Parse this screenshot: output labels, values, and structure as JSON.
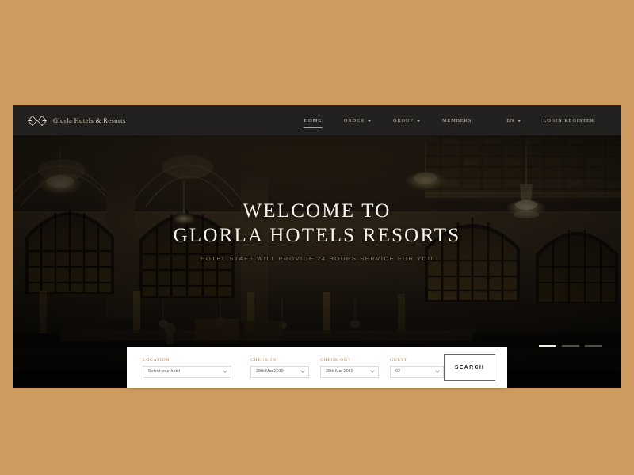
{
  "theme": {
    "page_background": "#cd9a5f",
    "header_background": "#232120",
    "accent": "#c37d3c",
    "hero_text": "#f7f3ec"
  },
  "header": {
    "brand": {
      "logo_icon": "double-diamond-monogram-icon",
      "name": "Glorla Hotels & Resorts"
    },
    "nav": [
      {
        "label": "HOME",
        "has_dropdown": false,
        "active": true
      },
      {
        "label": "ORDER",
        "has_dropdown": true,
        "active": false
      },
      {
        "label": "GROUP",
        "has_dropdown": true,
        "active": false
      },
      {
        "label": "MEMBERS",
        "has_dropdown": false,
        "active": false
      },
      {
        "label": "EN",
        "has_dropdown": true,
        "active": false
      },
      {
        "label": "LOGIN/REGISTER",
        "has_dropdown": false,
        "active": false
      }
    ]
  },
  "hero": {
    "title_line1": "WELCOME TO",
    "title_line2": "GLORLA HOTELS RESORTS",
    "subtitle": "HOTEL STAFF WILL PROVIDE 24 HOURS SERVICE FOR YOU",
    "image_description": "Grand hotel lobby with arched windows, vaulted coffered ceiling and chandeliers",
    "slides": [
      {
        "index": 1,
        "active": true
      },
      {
        "index": 2,
        "active": false
      },
      {
        "index": 3,
        "active": false
      }
    ]
  },
  "booking": {
    "fields": [
      {
        "label": "LOCATION",
        "value": "Select your hotel",
        "icon": "chevron-down-icon"
      },
      {
        "label": "CHECK IN",
        "value": "28th Mar 2019",
        "icon": "chevron-down-icon"
      },
      {
        "label": "CHECK OUT",
        "value": "28th Mar 2019",
        "icon": "chevron-down-icon"
      },
      {
        "label": "GUEST",
        "value": "02",
        "icon": "chevron-down-icon"
      }
    ],
    "search_label": "SEARCH"
  }
}
